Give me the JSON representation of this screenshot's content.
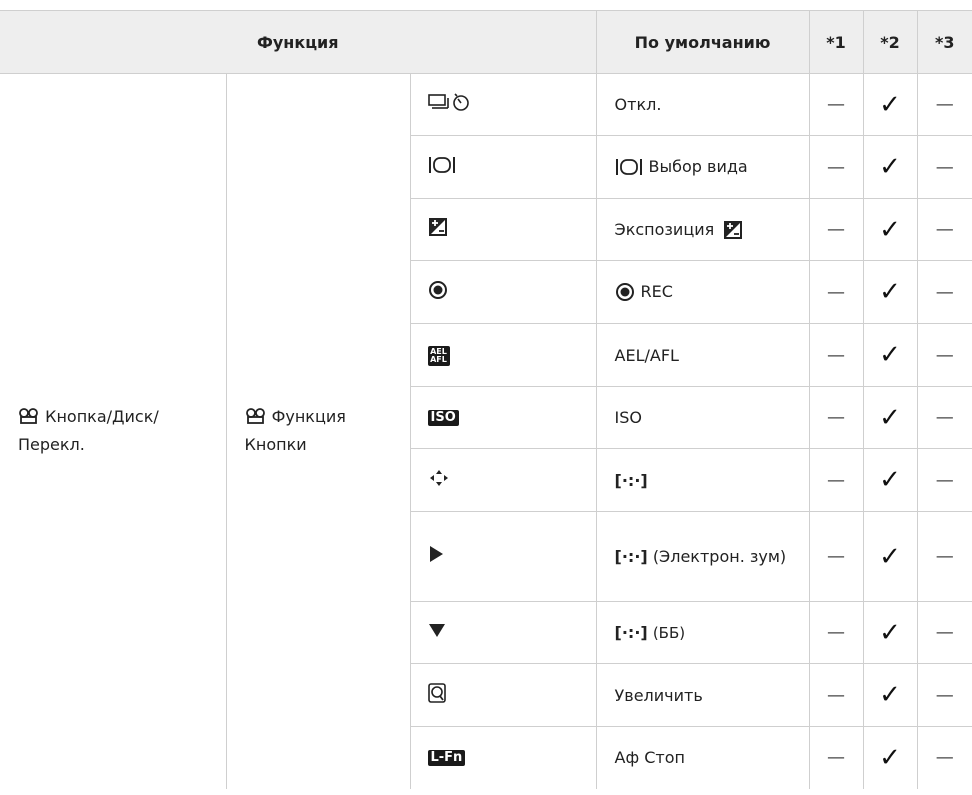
{
  "header": {
    "function": "Функция",
    "default": "По умолчанию",
    "col1": "*1",
    "col2": "*2",
    "col3": "*3"
  },
  "group": {
    "level1": "Кнопка/Диск/ Перекл.",
    "level2": "Функция Кнопки",
    "movie_icon": "movie-mode-icon"
  },
  "rows": [
    {
      "icon": "drive-self-timer-icon",
      "default": "Откл.",
      "c1": "—",
      "c2": "✓",
      "c3": "—"
    },
    {
      "icon": "view-selection-icon",
      "default": "Выбор вида",
      "c1": "—",
      "c2": "✓",
      "c3": "—"
    },
    {
      "icon": "exposure-compensation-icon",
      "default": "Экспозиция",
      "c1": "—",
      "c2": "✓",
      "c3": "—"
    },
    {
      "icon": "record-icon",
      "default": "REC",
      "c1": "—",
      "c2": "✓",
      "c3": "—"
    },
    {
      "icon": "ael-afl-icon",
      "default": "AEL/AFL",
      "c1": "—",
      "c2": "✓",
      "c3": "—"
    },
    {
      "icon": "iso-icon",
      "default": "ISO",
      "c1": "—",
      "c2": "✓",
      "c3": "—"
    },
    {
      "icon": "arrow-pad-icon",
      "default": "[·:·]",
      "c1": "—",
      "c2": "✓",
      "c3": "—"
    },
    {
      "icon": "play-triangle-icon",
      "default": "(Электрон. зум)",
      "c1": "—",
      "c2": "✓",
      "c3": "—"
    },
    {
      "icon": "down-triangle-icon",
      "default": "(ББ)",
      "c1": "—",
      "c2": "✓",
      "c3": "—"
    },
    {
      "icon": "magnify-icon",
      "default": "Увеличить",
      "c1": "—",
      "c2": "✓",
      "c3": "—"
    },
    {
      "icon": "l-fn-icon",
      "default": "Аф Стоп",
      "c1": "—",
      "c2": "✓",
      "c3": "—"
    }
  ],
  "badges": {
    "ael": "AEL AFL",
    "iso": "ISO",
    "lfn": "L-Fn"
  },
  "frame_glyph": "[·:·]"
}
